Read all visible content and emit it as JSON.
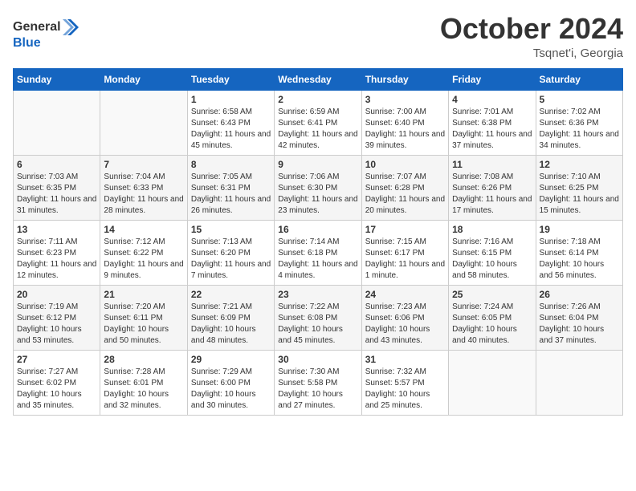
{
  "header": {
    "logo_line1": "General",
    "logo_line2": "Blue",
    "month": "October 2024",
    "location": "Tsqnet'i, Georgia"
  },
  "days_of_week": [
    "Sunday",
    "Monday",
    "Tuesday",
    "Wednesday",
    "Thursday",
    "Friday",
    "Saturday"
  ],
  "weeks": [
    [
      {
        "day": "",
        "sunrise": "",
        "sunset": "",
        "daylight": ""
      },
      {
        "day": "",
        "sunrise": "",
        "sunset": "",
        "daylight": ""
      },
      {
        "day": "1",
        "sunrise": "Sunrise: 6:58 AM",
        "sunset": "Sunset: 6:43 PM",
        "daylight": "Daylight: 11 hours and 45 minutes."
      },
      {
        "day": "2",
        "sunrise": "Sunrise: 6:59 AM",
        "sunset": "Sunset: 6:41 PM",
        "daylight": "Daylight: 11 hours and 42 minutes."
      },
      {
        "day": "3",
        "sunrise": "Sunrise: 7:00 AM",
        "sunset": "Sunset: 6:40 PM",
        "daylight": "Daylight: 11 hours and 39 minutes."
      },
      {
        "day": "4",
        "sunrise": "Sunrise: 7:01 AM",
        "sunset": "Sunset: 6:38 PM",
        "daylight": "Daylight: 11 hours and 37 minutes."
      },
      {
        "day": "5",
        "sunrise": "Sunrise: 7:02 AM",
        "sunset": "Sunset: 6:36 PM",
        "daylight": "Daylight: 11 hours and 34 minutes."
      }
    ],
    [
      {
        "day": "6",
        "sunrise": "Sunrise: 7:03 AM",
        "sunset": "Sunset: 6:35 PM",
        "daylight": "Daylight: 11 hours and 31 minutes."
      },
      {
        "day": "7",
        "sunrise": "Sunrise: 7:04 AM",
        "sunset": "Sunset: 6:33 PM",
        "daylight": "Daylight: 11 hours and 28 minutes."
      },
      {
        "day": "8",
        "sunrise": "Sunrise: 7:05 AM",
        "sunset": "Sunset: 6:31 PM",
        "daylight": "Daylight: 11 hours and 26 minutes."
      },
      {
        "day": "9",
        "sunrise": "Sunrise: 7:06 AM",
        "sunset": "Sunset: 6:30 PM",
        "daylight": "Daylight: 11 hours and 23 minutes."
      },
      {
        "day": "10",
        "sunrise": "Sunrise: 7:07 AM",
        "sunset": "Sunset: 6:28 PM",
        "daylight": "Daylight: 11 hours and 20 minutes."
      },
      {
        "day": "11",
        "sunrise": "Sunrise: 7:08 AM",
        "sunset": "Sunset: 6:26 PM",
        "daylight": "Daylight: 11 hours and 17 minutes."
      },
      {
        "day": "12",
        "sunrise": "Sunrise: 7:10 AM",
        "sunset": "Sunset: 6:25 PM",
        "daylight": "Daylight: 11 hours and 15 minutes."
      }
    ],
    [
      {
        "day": "13",
        "sunrise": "Sunrise: 7:11 AM",
        "sunset": "Sunset: 6:23 PM",
        "daylight": "Daylight: 11 hours and 12 minutes."
      },
      {
        "day": "14",
        "sunrise": "Sunrise: 7:12 AM",
        "sunset": "Sunset: 6:22 PM",
        "daylight": "Daylight: 11 hours and 9 minutes."
      },
      {
        "day": "15",
        "sunrise": "Sunrise: 7:13 AM",
        "sunset": "Sunset: 6:20 PM",
        "daylight": "Daylight: 11 hours and 7 minutes."
      },
      {
        "day": "16",
        "sunrise": "Sunrise: 7:14 AM",
        "sunset": "Sunset: 6:18 PM",
        "daylight": "Daylight: 11 hours and 4 minutes."
      },
      {
        "day": "17",
        "sunrise": "Sunrise: 7:15 AM",
        "sunset": "Sunset: 6:17 PM",
        "daylight": "Daylight: 11 hours and 1 minute."
      },
      {
        "day": "18",
        "sunrise": "Sunrise: 7:16 AM",
        "sunset": "Sunset: 6:15 PM",
        "daylight": "Daylight: 10 hours and 58 minutes."
      },
      {
        "day": "19",
        "sunrise": "Sunrise: 7:18 AM",
        "sunset": "Sunset: 6:14 PM",
        "daylight": "Daylight: 10 hours and 56 minutes."
      }
    ],
    [
      {
        "day": "20",
        "sunrise": "Sunrise: 7:19 AM",
        "sunset": "Sunset: 6:12 PM",
        "daylight": "Daylight: 10 hours and 53 minutes."
      },
      {
        "day": "21",
        "sunrise": "Sunrise: 7:20 AM",
        "sunset": "Sunset: 6:11 PM",
        "daylight": "Daylight: 10 hours and 50 minutes."
      },
      {
        "day": "22",
        "sunrise": "Sunrise: 7:21 AM",
        "sunset": "Sunset: 6:09 PM",
        "daylight": "Daylight: 10 hours and 48 minutes."
      },
      {
        "day": "23",
        "sunrise": "Sunrise: 7:22 AM",
        "sunset": "Sunset: 6:08 PM",
        "daylight": "Daylight: 10 hours and 45 minutes."
      },
      {
        "day": "24",
        "sunrise": "Sunrise: 7:23 AM",
        "sunset": "Sunset: 6:06 PM",
        "daylight": "Daylight: 10 hours and 43 minutes."
      },
      {
        "day": "25",
        "sunrise": "Sunrise: 7:24 AM",
        "sunset": "Sunset: 6:05 PM",
        "daylight": "Daylight: 10 hours and 40 minutes."
      },
      {
        "day": "26",
        "sunrise": "Sunrise: 7:26 AM",
        "sunset": "Sunset: 6:04 PM",
        "daylight": "Daylight: 10 hours and 37 minutes."
      }
    ],
    [
      {
        "day": "27",
        "sunrise": "Sunrise: 7:27 AM",
        "sunset": "Sunset: 6:02 PM",
        "daylight": "Daylight: 10 hours and 35 minutes."
      },
      {
        "day": "28",
        "sunrise": "Sunrise: 7:28 AM",
        "sunset": "Sunset: 6:01 PM",
        "daylight": "Daylight: 10 hours and 32 minutes."
      },
      {
        "day": "29",
        "sunrise": "Sunrise: 7:29 AM",
        "sunset": "Sunset: 6:00 PM",
        "daylight": "Daylight: 10 hours and 30 minutes."
      },
      {
        "day": "30",
        "sunrise": "Sunrise: 7:30 AM",
        "sunset": "Sunset: 5:58 PM",
        "daylight": "Daylight: 10 hours and 27 minutes."
      },
      {
        "day": "31",
        "sunrise": "Sunrise: 7:32 AM",
        "sunset": "Sunset: 5:57 PM",
        "daylight": "Daylight: 10 hours and 25 minutes."
      },
      {
        "day": "",
        "sunrise": "",
        "sunset": "",
        "daylight": ""
      },
      {
        "day": "",
        "sunrise": "",
        "sunset": "",
        "daylight": ""
      }
    ]
  ]
}
